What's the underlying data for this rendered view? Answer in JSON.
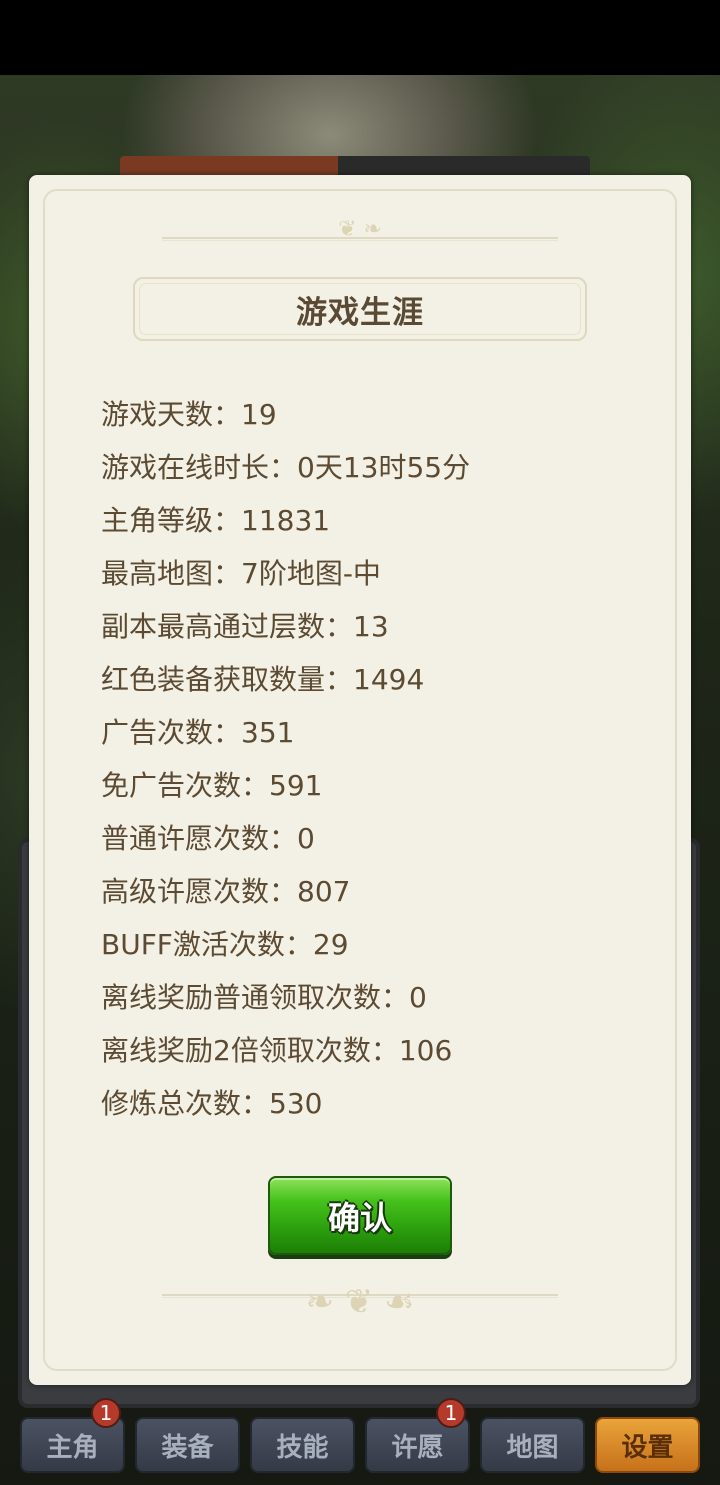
{
  "dialog": {
    "title": "游戏生涯",
    "stats": [
      "游戏天数：19",
      "游戏在线时长：0天13时55分",
      "主角等级：11831",
      "最高地图：7阶地图-中",
      "副本最高通过层数：13",
      "红色装备获取数量：1494",
      "广告次数：351",
      "免广告次数：591",
      "普通许愿次数：0",
      "高级许愿次数：807",
      "BUFF激活次数：29",
      "离线奖励普通领取次数：0",
      "离线奖励2倍领取次数：106",
      "修炼总次数：530"
    ],
    "confirm_label": "确认"
  },
  "tabs": [
    {
      "label": "主角",
      "badge": "1"
    },
    {
      "label": "装备",
      "badge": ""
    },
    {
      "label": "技能",
      "badge": ""
    },
    {
      "label": "许愿",
      "badge": "1"
    },
    {
      "label": "地图",
      "badge": ""
    },
    {
      "label": "设置",
      "badge": "",
      "active": true
    }
  ],
  "colors": {
    "dialog_bg": "#f3f1e6",
    "text": "#5c4a32",
    "confirm_green": "#2a9d0d",
    "active_tab": "#e9a53a",
    "badge_red": "#b53a2c"
  }
}
